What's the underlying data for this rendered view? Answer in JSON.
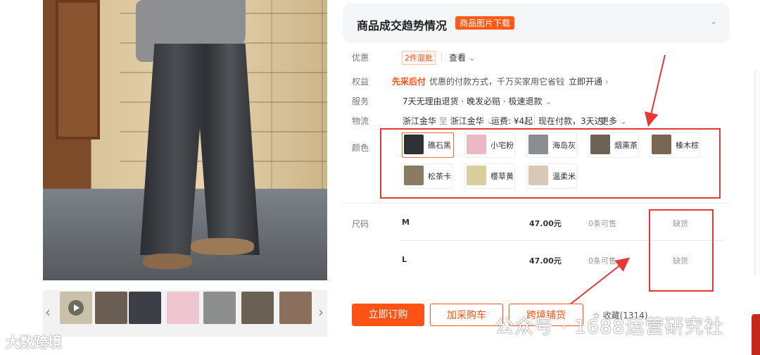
{
  "colors": {
    "accent": "#ff5316",
    "annotation_red": "#e53935"
  },
  "gallery": {
    "thumbnails": [
      {
        "name": "thumb-video",
        "color": "#c9c2a8"
      },
      {
        "name": "thumb-2",
        "color": "#6b5e55"
      },
      {
        "name": "thumb-3",
        "color": "#3c3f45"
      },
      {
        "name": "thumb-4",
        "color": "#efc6cf"
      },
      {
        "name": "thumb-5",
        "color": "#8d8f8e"
      },
      {
        "name": "thumb-6",
        "color": "#6b6054"
      },
      {
        "name": "thumb-7",
        "color": "#8a6f5c"
      }
    ],
    "prev_icon": "chevron-left-icon",
    "next_icon": "chevron-right-icon"
  },
  "trend": {
    "title": "商品成交趋势情况",
    "badge": "商品图片下载",
    "chevron": "chevron-down-icon"
  },
  "promo": {
    "label": "优惠",
    "tag": "2件混批",
    "link": "查看",
    "chev": "⌄"
  },
  "rights": {
    "label": "权益",
    "tag": "先采后付",
    "text": "优惠的付款方式，千万买家用它省钱",
    "link": "立即开通",
    "arrow": "›"
  },
  "service": {
    "label": "服务",
    "text": "7天无理由退货 · 晚发必赔 · 极速退款",
    "chev": "⌄"
  },
  "logistics": {
    "label": "物流",
    "from": "浙江金华",
    "to_word": "至",
    "to": "浙江金华",
    "chev": "⌄",
    "fee": "运费: ¥4起",
    "delivery": "现在付款，3天达",
    "more": "更多"
  },
  "color_label": "颜色",
  "color_options": [
    {
      "label": "礁石黑",
      "swatch": "#2f3136",
      "selected": true
    },
    {
      "label": "小宅粉",
      "swatch": "#e9b9c4",
      "selected": false
    },
    {
      "label": "海岛灰",
      "swatch": "#8a8d92",
      "selected": false
    },
    {
      "label": "烟熏茶",
      "swatch": "#6e6256",
      "selected": false
    },
    {
      "label": "榛木棕",
      "swatch": "#7a6652",
      "selected": false
    },
    {
      "label": "松茶卡",
      "swatch": "#8c7b63",
      "selected": false
    },
    {
      "label": "樱草黄",
      "swatch": "#d8cf9c",
      "selected": false
    },
    {
      "label": "温柔米",
      "swatch": "#d7c9b5",
      "selected": false
    }
  ],
  "size_label": "尺码",
  "sizes": [
    {
      "size": "M",
      "price": "47.00元",
      "stock": "0条可售",
      "status": "缺货"
    },
    {
      "size": "L",
      "price": "47.00元",
      "stock": "0条可售",
      "status": "缺货"
    }
  ],
  "actions": {
    "buy": "立即订购",
    "cart": "加采购车",
    "cross": "跨境铺货",
    "fav": "收藏(1314)",
    "fav_icon": "star-icon"
  },
  "watermarks": {
    "left": "大数跨境",
    "right": "公众号 · 1688运营研究社"
  }
}
